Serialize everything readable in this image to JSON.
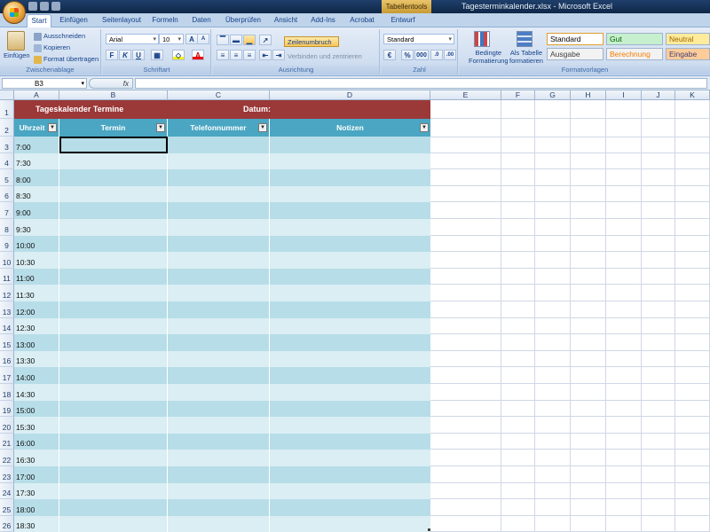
{
  "window": {
    "title": "Tagesterminkalender.xlsx - Microsoft Excel",
    "context_tab": "Tabellentools"
  },
  "tabs": [
    "Start",
    "Einfügen",
    "Seitenlayout",
    "Formeln",
    "Daten",
    "Überprüfen",
    "Ansicht",
    "Add-Ins",
    "Acrobat",
    "Entwurf"
  ],
  "ribbon": {
    "clipboard": {
      "paste": "Einfügen",
      "cut": "Ausschneiden",
      "copy": "Kopieren",
      "format_painter": "Format übertragen",
      "label": "Zwischenablage"
    },
    "font": {
      "name": "Arial",
      "size": "10",
      "label": "Schriftart",
      "bold": "F",
      "italic": "K",
      "underline": "U"
    },
    "alignment": {
      "wrap": "Zeilenumbruch",
      "merge": "Verbinden und zentrieren",
      "label": "Ausrichtung"
    },
    "number": {
      "format": "Standard",
      "label": "Zahl",
      "percent": "%",
      "thousands": "000"
    },
    "styles": {
      "cond_format_1": "Bedingte",
      "cond_format_2": "Formatierung",
      "as_table_1": "Als Tabelle",
      "as_table_2": "formatieren",
      "label": "Formatvorlagen",
      "cells": [
        {
          "text": "Standard",
          "bg": "#ffffff",
          "color": "#000000"
        },
        {
          "text": "Gut",
          "bg": "#c6efce",
          "color": "#006100"
        },
        {
          "text": "Neutral",
          "bg": "#ffeb9c",
          "color": "#9c6500"
        },
        {
          "text": "Ausgabe",
          "bg": "#f2f2f2",
          "color": "#3f3f3f"
        },
        {
          "text": "Berechnung",
          "bg": "#f2f2f2",
          "color": "#fa7d00"
        },
        {
          "text": "Eingabe",
          "bg": "#ffcc99",
          "color": "#3f3f76"
        }
      ]
    }
  },
  "formula_bar": {
    "cell_ref": "B3",
    "fx": "fx",
    "value": ""
  },
  "columns": [
    "A",
    "B",
    "C",
    "D",
    "E",
    "F",
    "G",
    "H",
    "I",
    "J",
    "K"
  ],
  "sheet": {
    "title": "Tageskalender Termine",
    "date_label": "Datum:",
    "headers": [
      "Uhrzeit",
      "Termin",
      "Telefonnummer",
      "Notizen"
    ],
    "rows": [
      {
        "n": "3",
        "time": "7:00"
      },
      {
        "n": "4",
        "time": "7:30"
      },
      {
        "n": "5",
        "time": "8:00"
      },
      {
        "n": "6",
        "time": "8:30"
      },
      {
        "n": "7",
        "time": "9:00"
      },
      {
        "n": "8",
        "time": "9:30"
      },
      {
        "n": "9",
        "time": "10:00"
      },
      {
        "n": "10",
        "time": "10:30"
      },
      {
        "n": "11",
        "time": "11:00"
      },
      {
        "n": "12",
        "time": "11:30"
      },
      {
        "n": "13",
        "time": "12:00"
      },
      {
        "n": "14",
        "time": "12:30"
      },
      {
        "n": "15",
        "time": "13:00"
      },
      {
        "n": "16",
        "time": "13:30"
      },
      {
        "n": "17",
        "time": "14:00"
      },
      {
        "n": "18",
        "time": "14:30"
      },
      {
        "n": "19",
        "time": "15:00"
      },
      {
        "n": "20",
        "time": "15:30"
      },
      {
        "n": "21",
        "time": "16:00"
      },
      {
        "n": "22",
        "time": "16:30"
      },
      {
        "n": "23",
        "time": "17:00"
      },
      {
        "n": "24",
        "time": "17:30"
      },
      {
        "n": "25",
        "time": "18:00"
      },
      {
        "n": "26",
        "time": "18:30"
      }
    ]
  },
  "colors": {
    "title_bg": "#9b3838",
    "header_bg": "#4aa6c2",
    "band_dark": "#b7dde8",
    "band_light": "#daeef3"
  }
}
